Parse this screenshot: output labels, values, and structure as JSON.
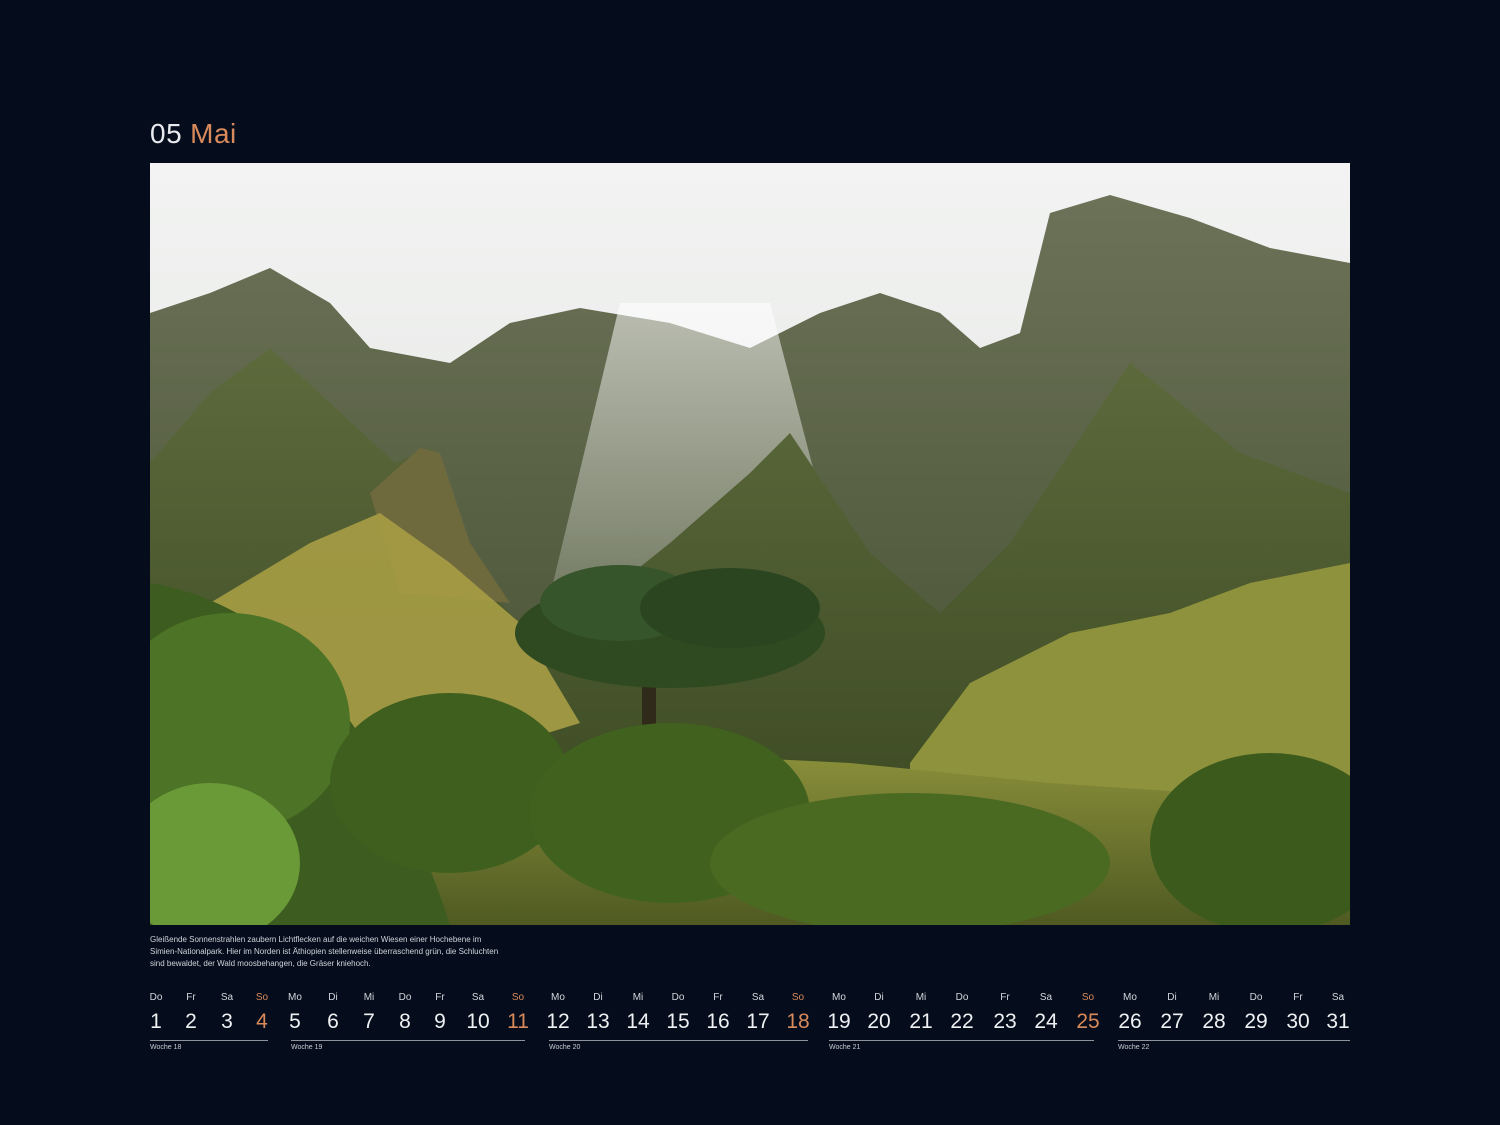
{
  "header": {
    "month_number": "05",
    "month_name": "Mai"
  },
  "photo": {
    "icon": "mountain-landscape-photo"
  },
  "caption": {
    "line1": "Gleißende Sonnenstrahlen zaubern Lichtflecken auf die weichen Wiesen einer Hochebene im",
    "line2": "Simien-Nationalpark. Hier im Norden ist Äthiopien stellenweise überraschend grün, die Schluchten",
    "line3": "sind bewaldet, der Wald moosbehangen, die Gräser kniehoch."
  },
  "calendar": {
    "days": [
      {
        "wd": "Do",
        "d": "1"
      },
      {
        "wd": "Fr",
        "d": "2"
      },
      {
        "wd": "Sa",
        "d": "3"
      },
      {
        "wd": "So",
        "d": "4",
        "sun": true
      },
      {
        "wd": "Mo",
        "d": "5"
      },
      {
        "wd": "Di",
        "d": "6"
      },
      {
        "wd": "Mi",
        "d": "7"
      },
      {
        "wd": "Do",
        "d": "8"
      },
      {
        "wd": "Fr",
        "d": "9"
      },
      {
        "wd": "Sa",
        "d": "10"
      },
      {
        "wd": "So",
        "d": "11",
        "sun": true
      },
      {
        "wd": "Mo",
        "d": "12"
      },
      {
        "wd": "Di",
        "d": "13"
      },
      {
        "wd": "Mi",
        "d": "14"
      },
      {
        "wd": "Do",
        "d": "15"
      },
      {
        "wd": "Fr",
        "d": "16"
      },
      {
        "wd": "Sa",
        "d": "17"
      },
      {
        "wd": "So",
        "d": "18",
        "sun": true
      },
      {
        "wd": "Mo",
        "d": "19"
      },
      {
        "wd": "Di",
        "d": "20"
      },
      {
        "wd": "Mi",
        "d": "21"
      },
      {
        "wd": "Do",
        "d": "22"
      },
      {
        "wd": "Fr",
        "d": "23"
      },
      {
        "wd": "Sa",
        "d": "24"
      },
      {
        "wd": "So",
        "d": "25",
        "sun": true
      },
      {
        "wd": "Mo",
        "d": "26"
      },
      {
        "wd": "Di",
        "d": "27"
      },
      {
        "wd": "Mi",
        "d": "28"
      },
      {
        "wd": "Do",
        "d": "29"
      },
      {
        "wd": "Fr",
        "d": "30"
      },
      {
        "wd": "Sa",
        "d": "31"
      }
    ],
    "weeks": [
      {
        "label": "Woche 18"
      },
      {
        "label": "Woche 19"
      },
      {
        "label": "Woche 20"
      },
      {
        "label": "Woche 21"
      },
      {
        "label": "Woche 22"
      }
    ],
    "accent_color": "#d98a5b"
  }
}
